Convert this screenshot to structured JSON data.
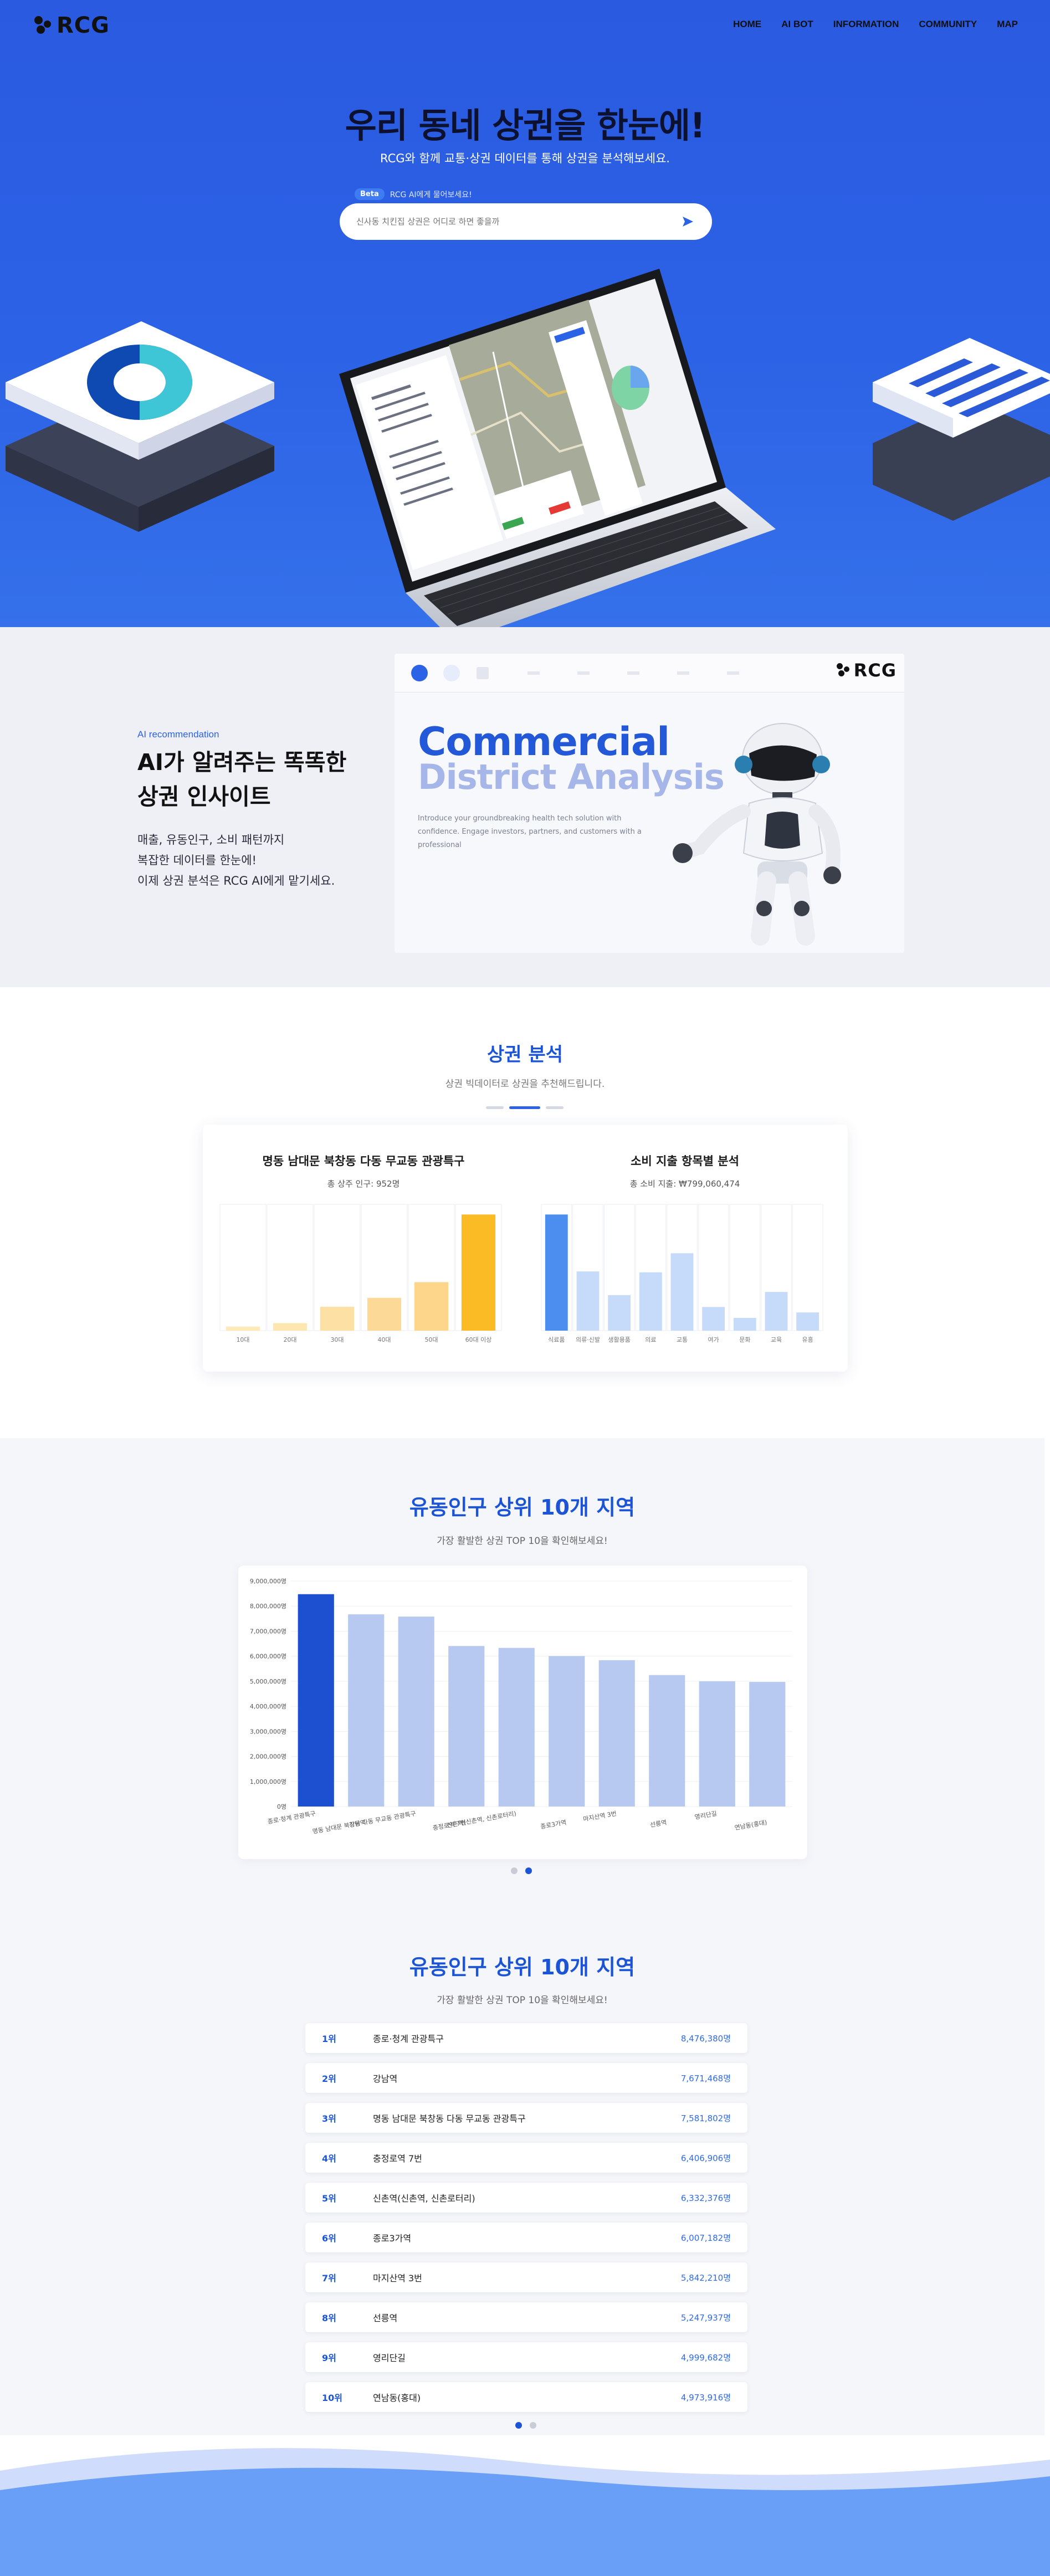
{
  "logo": {
    "text": "RCG"
  },
  "nav": {
    "items": [
      "HOME",
      "AI BOT",
      "INFORMATION",
      "COMMUNITY",
      "MAP"
    ]
  },
  "hero": {
    "title": "우리 동네 상권을 한눈에!",
    "subtitle": "RCG와 함께 교통·상권 데이터를 통해 상권을 분석해보세요.",
    "beta_badge": "Beta",
    "beta_note": "RCG AI에게 물어보세요!",
    "search_placeholder": "신사동 치킨집 상권은 어디로 하면 좋을까"
  },
  "ai_section": {
    "tag": "AI recommendation",
    "title": "AI가 알려주는 똑똑한 상권 인사이트",
    "desc_line1": "매출, 유동인구, 소비 패턴까지",
    "desc_line2": "복잡한 데이터를 한눈에!",
    "desc_line3": "이제 상권 분석은 RCG AI에게 맡기세요.",
    "card_title1": "Commercial",
    "card_title2": "District Analysis",
    "card_para": "Introduce your groundbreaking health tech solution with confidence. Engage investors, partners, and customers with a professional"
  },
  "district_analysis": {
    "title": "상권 분석",
    "subtitle": "상권 빅데이터로 상권을 추천해드립니다."
  },
  "chart_data": [
    {
      "type": "bar",
      "title": "명동 남대문 북창동 다동 무교동 관광특구",
      "subtitle": "총 상주 인구: 952명",
      "categories": [
        "10대",
        "20대",
        "30대",
        "40대",
        "50대",
        "60대 이상"
      ],
      "values": [
        30,
        55,
        175,
        240,
        355,
        850
      ],
      "ylim": [
        0,
        900
      ],
      "colors": [
        "#fde9b9",
        "#fde6b0",
        "#fde0a4",
        "#fdd998",
        "#fdd58b",
        "#fbbb24"
      ],
      "grid": false
    },
    {
      "type": "bar",
      "title": "소비 지출 항목별 분석",
      "subtitle": "총 소비 지출: ₩799,060,474",
      "categories": [
        "식료품",
        "의류·신발",
        "생활용품",
        "의료",
        "교통",
        "여가",
        "문화",
        "교육",
        "유흥"
      ],
      "values": [
        255,
        130,
        78,
        128,
        170,
        52,
        28,
        85,
        40
      ],
      "ylim": [
        0,
        270
      ],
      "colors": [
        "#4c8ef0",
        "#c6dbfa",
        "#c6dbfa",
        "#c6dbfa",
        "#c6dbfa",
        "#c6dbfa",
        "#c6dbfa",
        "#c6dbfa",
        "#c6dbfa"
      ],
      "grid": false
    },
    {
      "type": "bar",
      "title": "유동인구 상위 10개 지역",
      "subtitle": "가장 활발한 상권 TOP 10을 확인해보세요!",
      "categories": [
        "종로·청계 관광특구",
        "강남역",
        "명동 남대문 북창동 다동 무교동 관광특구",
        "충정로역 7번",
        "신촌역(신촌역, 신촌로터리)",
        "종로3가역",
        "마지산역 3번",
        "선릉역",
        "영리단길",
        "연남동(홍대)"
      ],
      "values": [
        8476380,
        7671468,
        7581802,
        6406906,
        6332376,
        6007182,
        5842210,
        5247937,
        4999682,
        4973916
      ],
      "ylim": [
        0,
        9000000
      ],
      "yticks": [
        "0명",
        "1,000,000명",
        "2,000,000명",
        "3,000,000명",
        "4,000,000명",
        "5,000,000명",
        "6,000,000명",
        "7,000,000명",
        "8,000,000명",
        "9,000,000명"
      ],
      "colors": [
        "#1d4fd1",
        "#b8c9f1",
        "#b8c9f1",
        "#b8c9f1",
        "#b8c9f1",
        "#b8c9f1",
        "#b8c9f1",
        "#b8c9f1",
        "#b8c9f1",
        "#b8c9f1"
      ],
      "grid": true
    }
  ],
  "floating_top10": {
    "title": "유동인구 상위 10개 지역",
    "subtitle": "가장 활발한 상권 TOP 10을 확인해보세요!"
  },
  "ranking": {
    "title": "유동인구 상위 10개 지역",
    "subtitle": "가장 활발한 상권 TOP 10을 확인해보세요!",
    "rows": [
      {
        "rank": "1위",
        "name": "종로·청계 관광특구",
        "value": "8,476,380명"
      },
      {
        "rank": "2위",
        "name": "강남역",
        "value": "7,671,468명"
      },
      {
        "rank": "3위",
        "name": "명동 남대문 북창동 다동 무교동 관광특구",
        "value": "7,581,802명"
      },
      {
        "rank": "4위",
        "name": "충정로역 7번",
        "value": "6,406,906명"
      },
      {
        "rank": "5위",
        "name": "신촌역(신촌역, 신촌로터리)",
        "value": "6,332,376명"
      },
      {
        "rank": "6위",
        "name": "종로3가역",
        "value": "6,007,182명"
      },
      {
        "rank": "7위",
        "name": "마지산역 3번",
        "value": "5,842,210명"
      },
      {
        "rank": "8위",
        "name": "선릉역",
        "value": "5,247,937명"
      },
      {
        "rank": "9위",
        "name": "영리단길",
        "value": "4,999,682명"
      },
      {
        "rank": "10위",
        "name": "연남동(홍대)",
        "value": "4,973,916명"
      }
    ]
  },
  "colors": {
    "primary": "#2c62e6",
    "accent": "#1b54d6",
    "amber": "#fbbb24",
    "wave": "#6a9ff7"
  }
}
